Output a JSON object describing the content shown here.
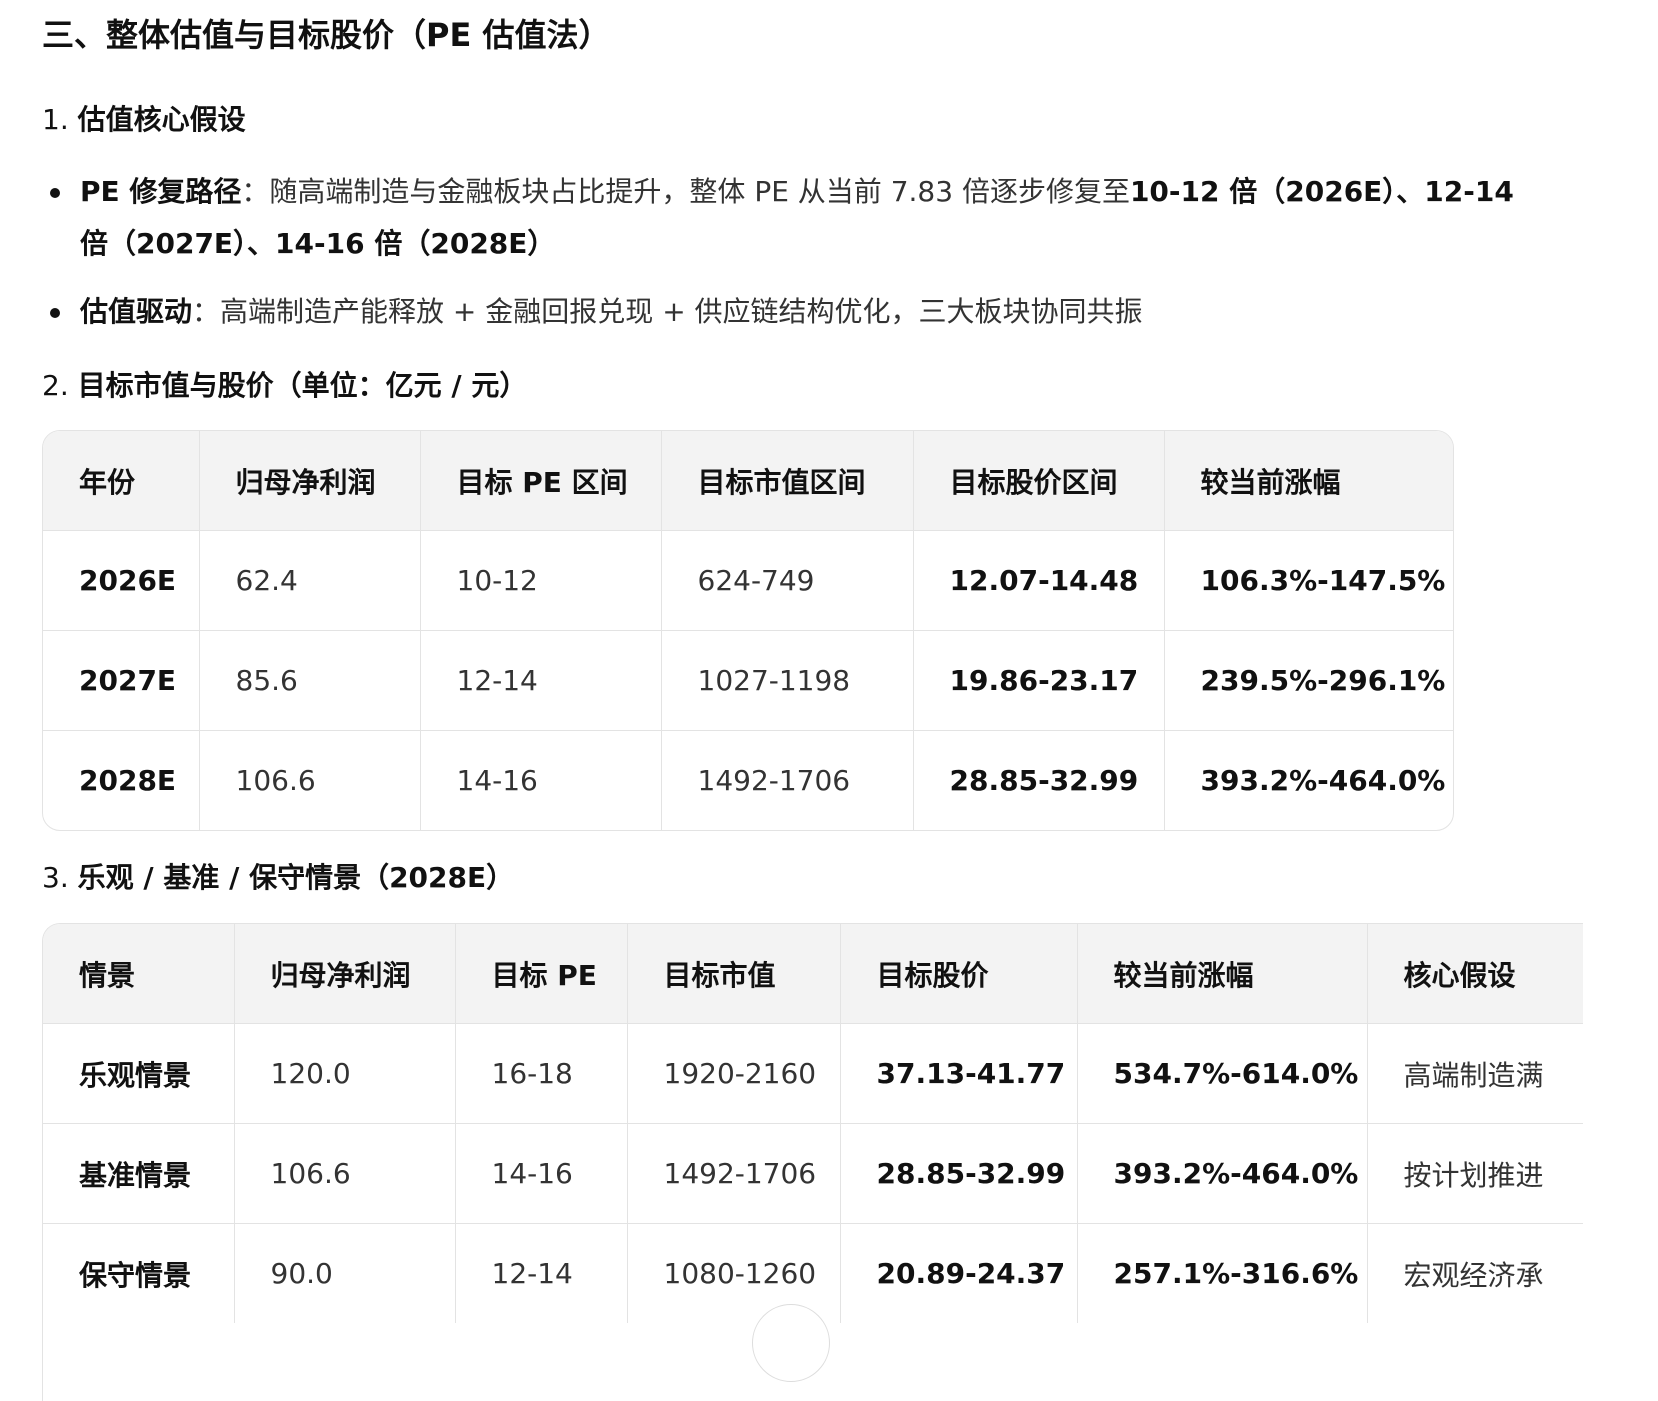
{
  "section_title": "三、整体估值与目标股价（PE 估值法）",
  "sub1": {
    "num": "1.",
    "title": "估值核心假设"
  },
  "bullets": [
    {
      "label": "PE 修复路径",
      "colon": "：",
      "text": "随高端制造与金融板块占比提升，整体 PE 从当前 7.83 倍逐步修复至",
      "bold_tail": "10-12 倍（2026E）、12-14 倍（2027E）、14-16 倍（2028E）"
    },
    {
      "label": "估值驱动",
      "colon": "：",
      "text": "高端制造产能释放 + 金融回报兑现 + 供应链结构优化，三大板块协同共振",
      "bold_tail": ""
    }
  ],
  "sub2": {
    "num": "2.",
    "title": "目标市值与股价（单位：亿元 / 元）"
  },
  "table1": {
    "headers": [
      "年份",
      "归母净利润",
      "目标 PE 区间",
      "目标市值区间",
      "目标股价区间",
      "较当前涨幅"
    ],
    "rows": [
      [
        "2026E",
        "62.4",
        "10-12",
        "624-749",
        "12.07-14.48",
        "106.3%-147.5%"
      ],
      [
        "2027E",
        "85.6",
        "12-14",
        "1027-1198",
        "19.86-23.17",
        "239.5%-296.1%"
      ],
      [
        "2028E",
        "106.6",
        "14-16",
        "1492-1706",
        "28.85-32.99",
        "393.2%-464.0%"
      ]
    ]
  },
  "sub3": {
    "num": "3.",
    "title": "乐观 / 基准 / 保守情景（2028E）"
  },
  "table2": {
    "headers": [
      "情景",
      "归母净利润",
      "目标 PE",
      "目标市值",
      "目标股价",
      "较当前涨幅",
      "核心假设"
    ],
    "rows": [
      [
        "乐观情景",
        "120.0",
        "16-18",
        "1920-2160",
        "37.13-41.77",
        "534.7%-614.0%",
        "高端制造满"
      ],
      [
        "基准情景",
        "106.6",
        "14-16",
        "1492-1706",
        "28.85-32.99",
        "393.2%-464.0%",
        "按计划推进"
      ],
      [
        "保守情景",
        "90.0",
        "12-14",
        "1080-1260",
        "20.89-24.37",
        "257.1%-316.6%",
        "宏观经济承"
      ]
    ]
  }
}
